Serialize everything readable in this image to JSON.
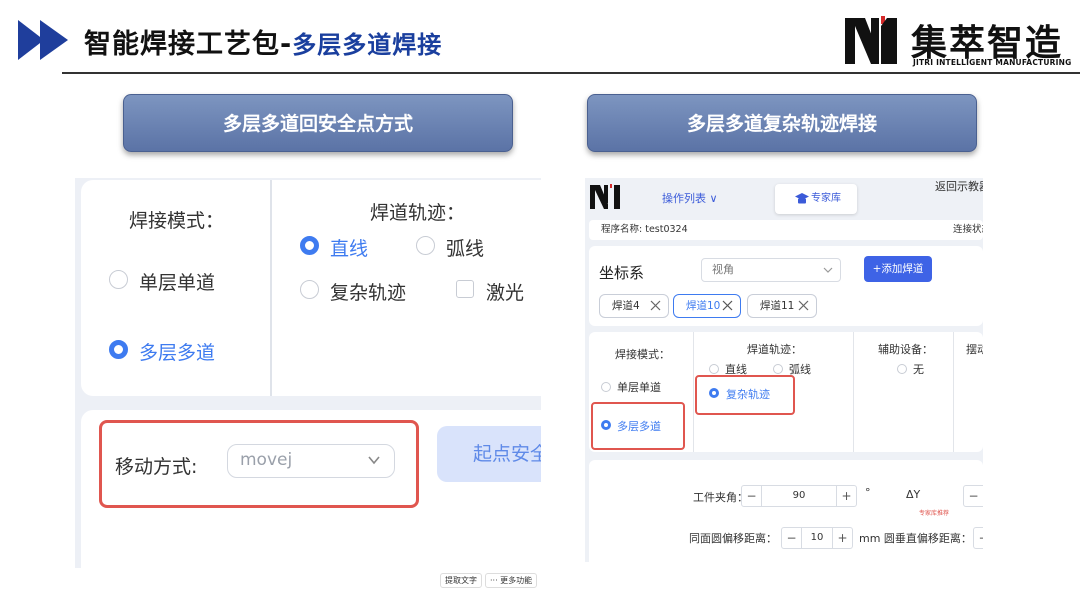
{
  "header": {
    "title_main": "智能焊接工艺包-",
    "title_sub": "多层多道焊接",
    "logo_cn": "集萃智造",
    "logo_en": "JITRI INTELLIGENT MANUFACTURING"
  },
  "banners": {
    "left": "多层多道回安全点方式",
    "right": "多层多道复杂轨迹焊接"
  },
  "left_panel": {
    "weld_mode_label": "焊接模式：",
    "mode_single": "单层单道",
    "mode_multi": "多层多道",
    "track_label": "焊道轨迹：",
    "track_line": "直线",
    "track_arc": "弧线",
    "track_complex": "复杂轨迹",
    "laser": "激光",
    "move_label": "移动方式:",
    "move_value": "movej",
    "start_button": "起点安全"
  },
  "tiny_buttons": {
    "extract": "提取文字",
    "more": "··· 更多功能"
  },
  "right_panel": {
    "ops_list": "操作列表 ∨",
    "expert": "专家库",
    "back": "返回示教器",
    "program_label": "程序名称: test0324",
    "connection": "连接状态",
    "coord_label": "坐标系",
    "view_placeholder": "视角",
    "add_weld": "+添加焊道",
    "tags": [
      "焊道4",
      "焊道10",
      "焊道11"
    ],
    "weld_mode_label": "焊接模式：",
    "mode_single": "单层单道",
    "mode_multi": "多层多道",
    "track_label": "焊道轨迹：",
    "track_line": "直线",
    "track_arc": "弧线",
    "track_complex": "复杂轨迹",
    "aux_label": "辅助设备：",
    "aux_none": "无",
    "swing_label": "摆动",
    "fixture_angle_label": "工件夹角：",
    "fixture_angle_value": "90",
    "degree": "°",
    "delta_y": "ΔY",
    "expert_recommend": "专家库推荐",
    "same_circle_label": "同面圆偏移距离：",
    "same_circle_value": "10",
    "mm_vertical": "mm 圆垂直偏移距离："
  },
  "colors": {
    "accent_blue": "#3e7bf0",
    "banner_blue": "#6a82b3",
    "highlight_red": "#e0564f",
    "title_blue": "#1a3f9e"
  }
}
